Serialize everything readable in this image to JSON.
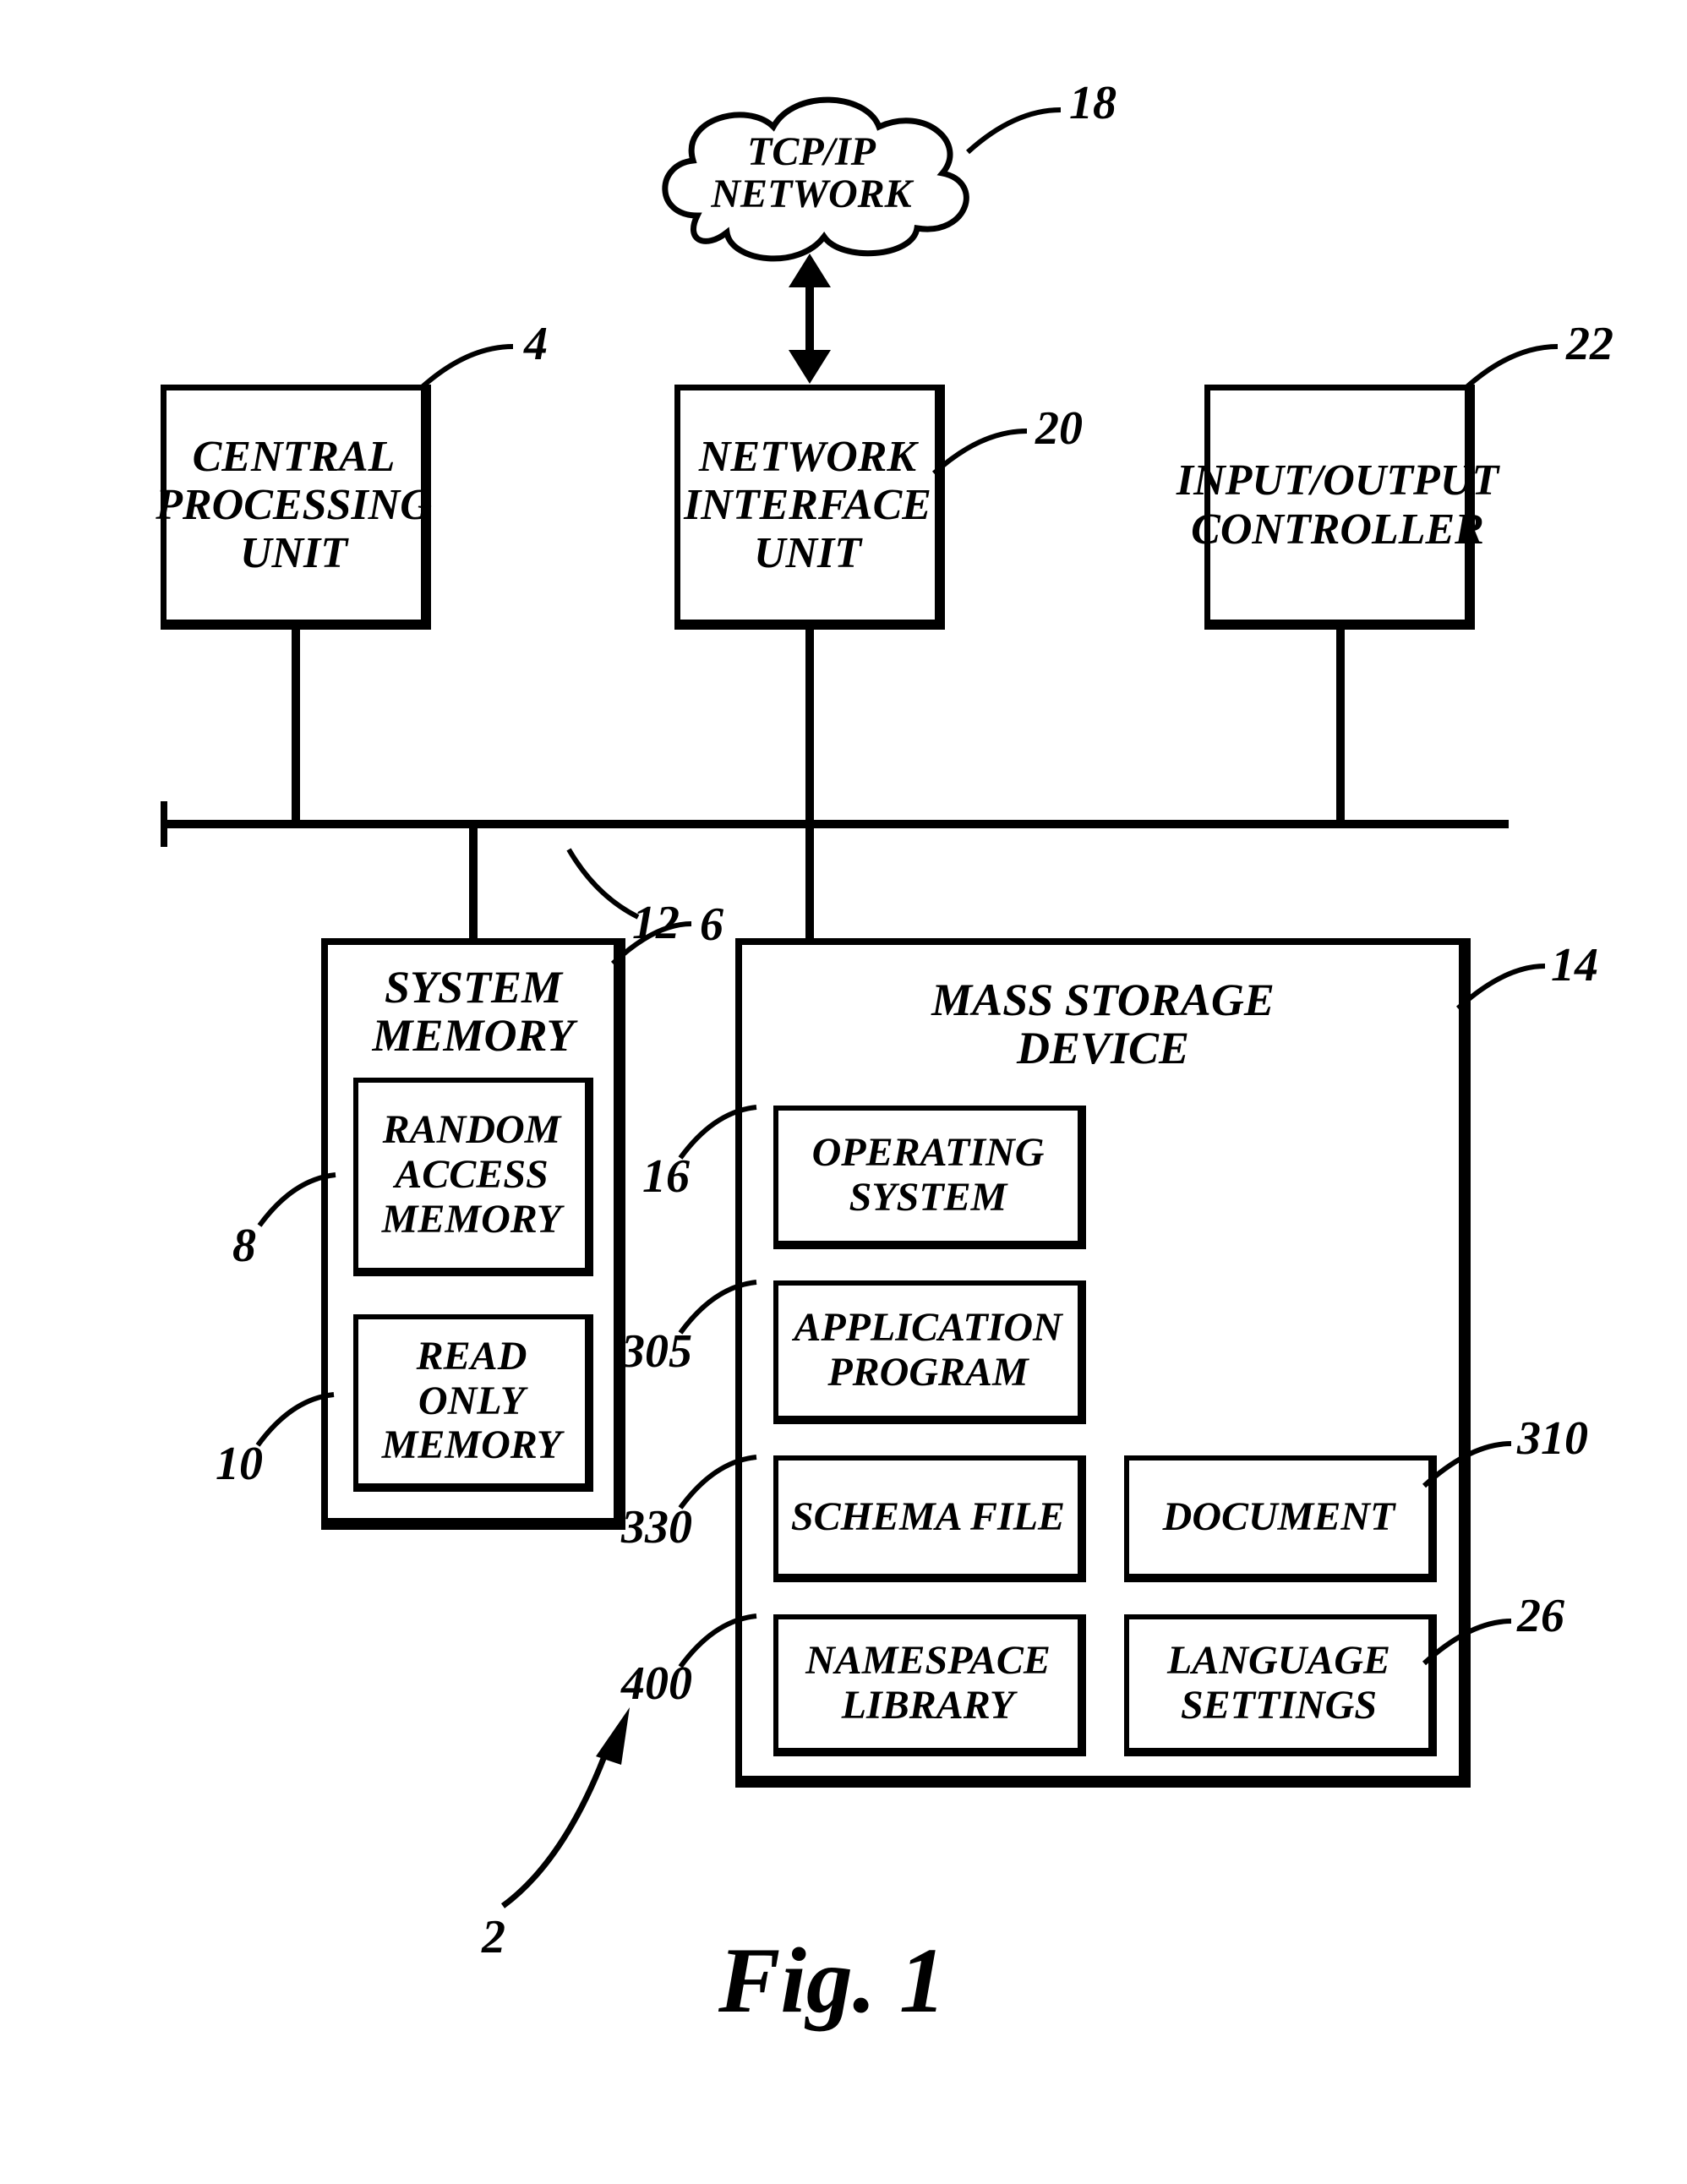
{
  "figure_caption": "Fig. 1",
  "refs": {
    "system": "2",
    "cpu": "4",
    "sys_mem": "6",
    "ram": "8",
    "rom": "10",
    "bus": "12",
    "mass_storage": "14",
    "os": "16",
    "network_cloud": "18",
    "nic": "20",
    "io": "22",
    "lang_settings": "26",
    "app_prog": "305",
    "document": "310",
    "schema_file": "330",
    "ns_library": "400"
  },
  "labels": {
    "cpu": "CENTRAL PROCESSING UNIT",
    "nic": "NETWORK INTERFACE UNIT",
    "io": "INPUT/OUTPUT CONTROLLER",
    "network_cloud": "TCP/IP NETWORK",
    "sys_mem_title": "SYSTEM MEMORY",
    "ram": "RANDOM ACCESS MEMORY",
    "rom": "READ ONLY MEMORY",
    "mass_storage_title": "MASS STORAGE DEVICE",
    "os": "OPERATING SYSTEM",
    "app_prog": "APPLICATION PROGRAM",
    "schema_file": "SCHEMA FILE",
    "document": "DOCUMENT",
    "ns_library": "NAMESPACE LIBRARY",
    "lang_settings": "LANGUAGE SETTINGS"
  }
}
